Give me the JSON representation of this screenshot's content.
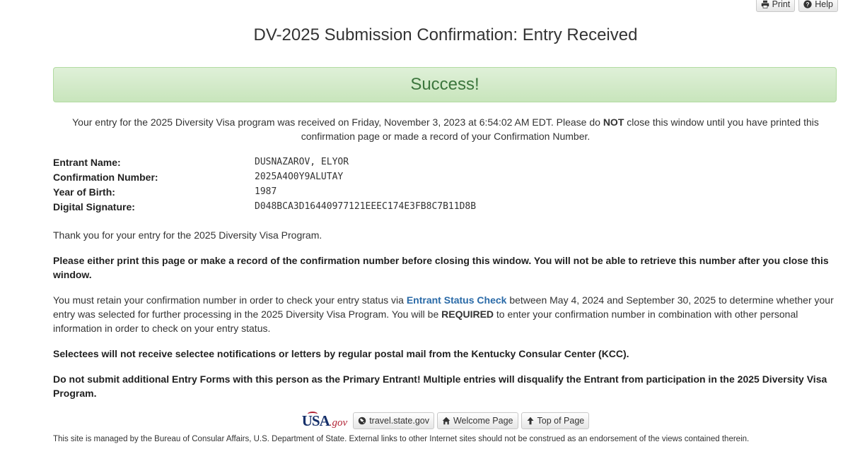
{
  "toolbar": {
    "print_label": "Print",
    "help_label": "Help"
  },
  "page": {
    "title": "DV-2025 Submission Confirmation: Entry Received"
  },
  "alert": {
    "message": "Success!"
  },
  "intro": {
    "text_before": "Your entry for the 2025 Diversity Visa program was received on Friday, November 3, 2023 at 6:54:02 AM EDT. Please do ",
    "emphasis": "NOT",
    "text_after": " close this window until you have printed this confirmation page or made a record of your Confirmation Number."
  },
  "details": [
    {
      "label": "Entrant Name:",
      "value": "DUSNAZAROV, ELYOR"
    },
    {
      "label": "Confirmation Number:",
      "value": "2025A4O0Y9ALUTAY"
    },
    {
      "label": "Year of Birth:",
      "value": "1987"
    },
    {
      "label": "Digital Signature:",
      "value": "D048BCA3D16440977121EEEC174E3FB8C7B11D8B"
    }
  ],
  "body": {
    "thanks": "Thank you for your entry for the 2025 Diversity Visa Program.",
    "print_warning": "Please either print this page or make a record of the confirmation number before closing this window. You will not be able to retrieve this number after you close this window.",
    "retain_before": "You must retain your confirmation number in order to check your entry status via ",
    "retain_link": "Entrant Status Check",
    "retain_middle": " between May 4, 2024 and September 30, 2025 to determine whether your entry was selected for further processing in the 2025 Diversity Visa Program. You will be ",
    "retain_required": "REQUIRED",
    "retain_after": " to enter your confirmation number in combination with other personal information in order to check on your entry status.",
    "selectees": "Selectees will not receive selectee notifications or letters by regular postal mail from the Kentucky Consular Center (KCC).",
    "no_additional": "Do not submit additional Entry Forms with this person as the Primary Entrant! Multiple entries will disqualify the Entrant from participation in the 2025 Diversity Visa Program."
  },
  "footer": {
    "logo_usa": "USA",
    "logo_gov": ".gov",
    "travel_label": "travel.state.gov",
    "welcome_label": "Welcome Page",
    "top_label": "Top of Page",
    "disclaimer": "This site is managed by the Bureau of Consular Affairs, U.S. Department of State. External links to other Internet sites should not be construed as an endorsement of the views contained therein."
  },
  "colors": {
    "success_text": "#3c763d",
    "success_bg": "#dff0d8",
    "link": "#2a6aa7"
  }
}
